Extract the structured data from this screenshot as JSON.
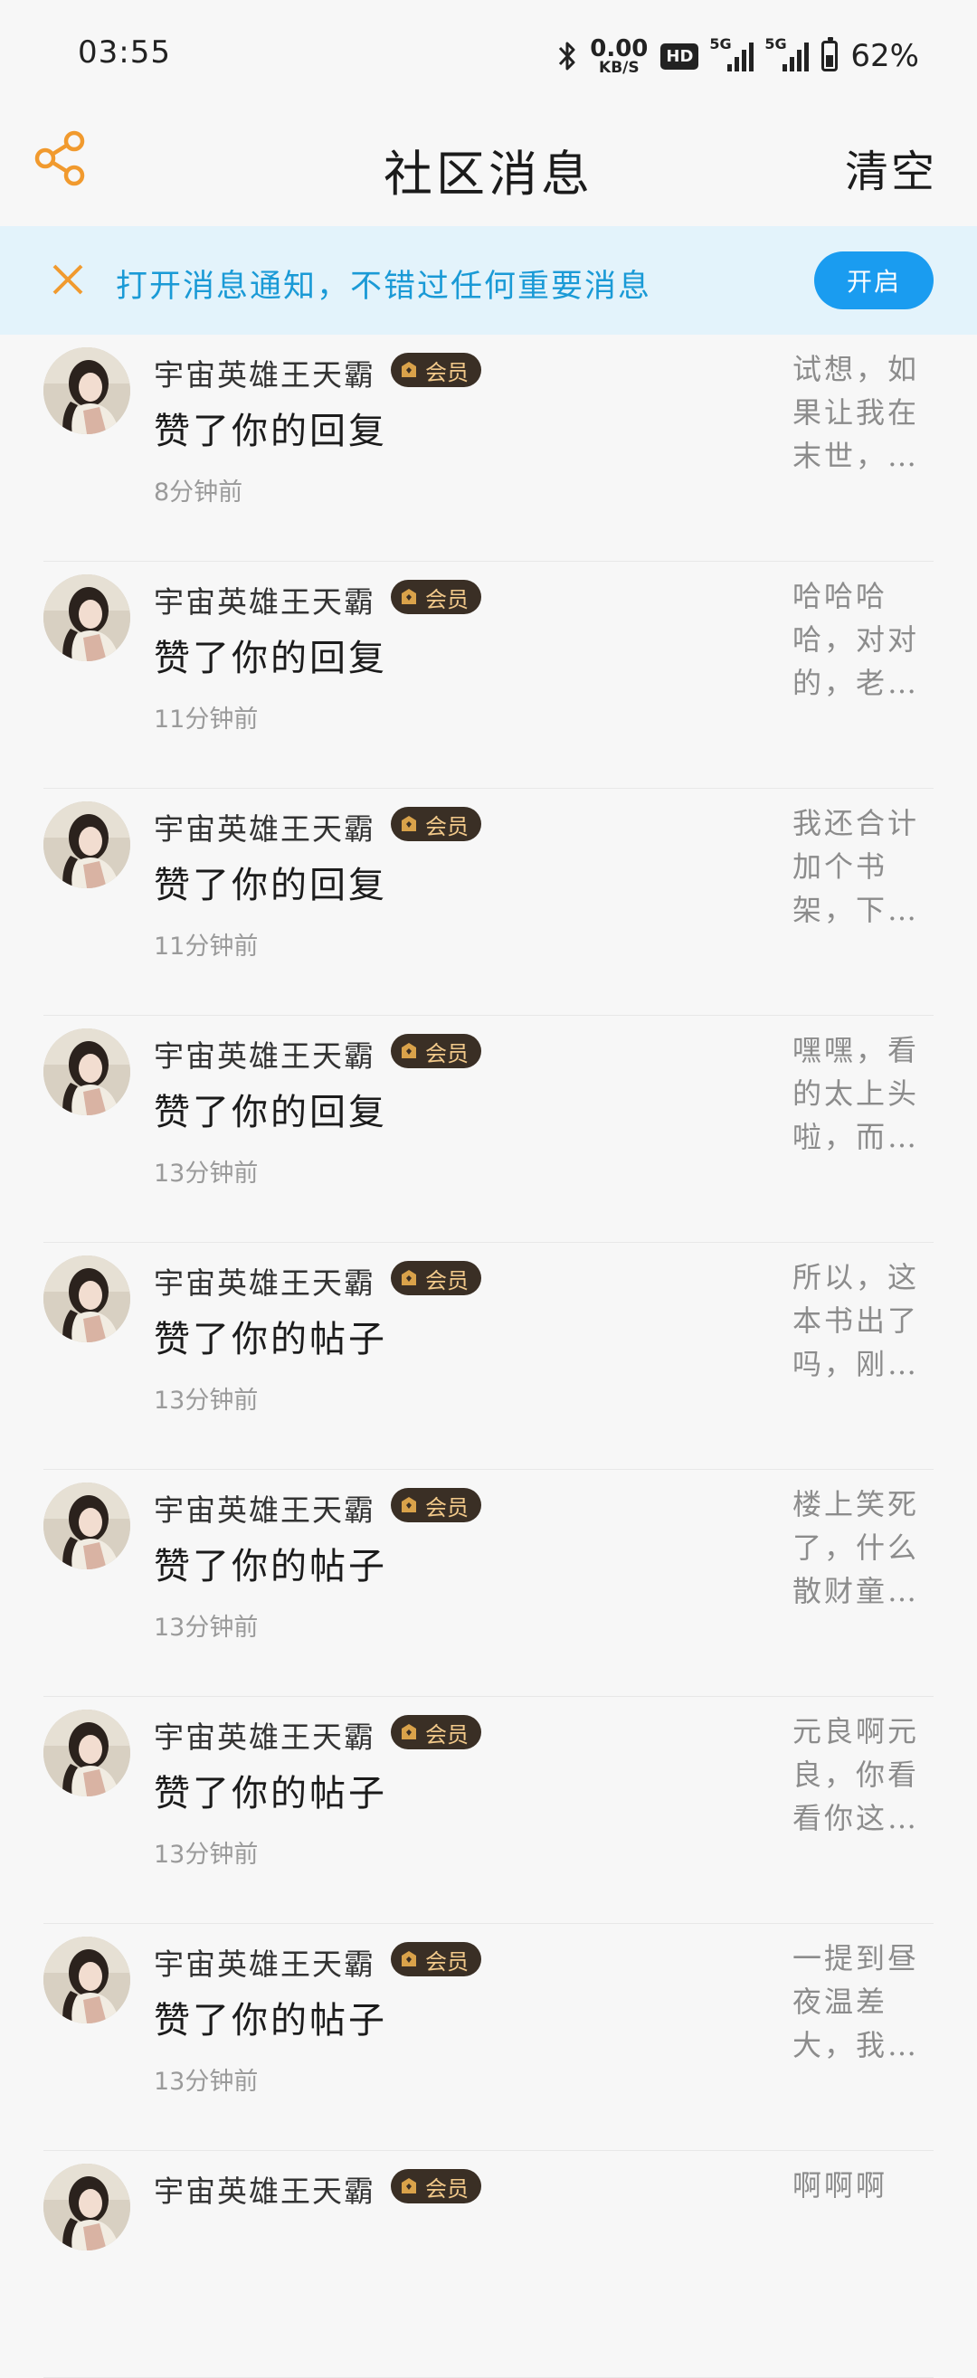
{
  "status_bar": {
    "time": "03:55",
    "net_speed_value": "0.00",
    "net_speed_unit": "KB/S",
    "hd_label": "HD",
    "signal1_label": "5G",
    "signal2_label": "5G",
    "battery_percent": "62%",
    "battery_level": 0.62
  },
  "header": {
    "title": "社区消息",
    "clear_label": "清空",
    "share_icon": "share-icon",
    "accent_color": "#f19a2e"
  },
  "notification_banner": {
    "text": "打开消息通知，不错过任何重要消息",
    "button_label": "开启",
    "close_icon": "close-icon"
  },
  "messages": [
    {
      "user": "宇宙英雄王天霸",
      "badge": "会员",
      "action": "赞了你的回复",
      "time": "8分钟前",
      "preview": "试想，如果让我在末世，…"
    },
    {
      "user": "宇宙英雄王天霸",
      "badge": "会员",
      "action": "赞了你的回复",
      "time": "11分钟前",
      "preview": "哈哈哈哈，对对的，老…"
    },
    {
      "user": "宇宙英雄王天霸",
      "badge": "会员",
      "action": "赞了你的回复",
      "time": "11分钟前",
      "preview": "我还合计加个书架，下…"
    },
    {
      "user": "宇宙英雄王天霸",
      "badge": "会员",
      "action": "赞了你的回复",
      "time": "13分钟前",
      "preview": "嘿嘿，看的太上头啦，而…"
    },
    {
      "user": "宇宙英雄王天霸",
      "badge": "会员",
      "action": "赞了你的帖子",
      "time": "13分钟前",
      "preview": "所以，这本书出了吗，刚…"
    },
    {
      "user": "宇宙英雄王天霸",
      "badge": "会员",
      "action": "赞了你的帖子",
      "time": "13分钟前",
      "preview": "楼上笑死了，什么散财童…"
    },
    {
      "user": "宇宙英雄王天霸",
      "badge": "会员",
      "action": "赞了你的帖子",
      "time": "13分钟前",
      "preview": "元良啊元良，你看看你这…"
    },
    {
      "user": "宇宙英雄王天霸",
      "badge": "会员",
      "action": "赞了你的帖子",
      "time": "13分钟前",
      "preview": "一提到昼夜温差大，我…"
    },
    {
      "user": "宇宙英雄王天霸",
      "badge": "会员",
      "action": "",
      "time": "",
      "preview": "啊啊啊"
    }
  ]
}
